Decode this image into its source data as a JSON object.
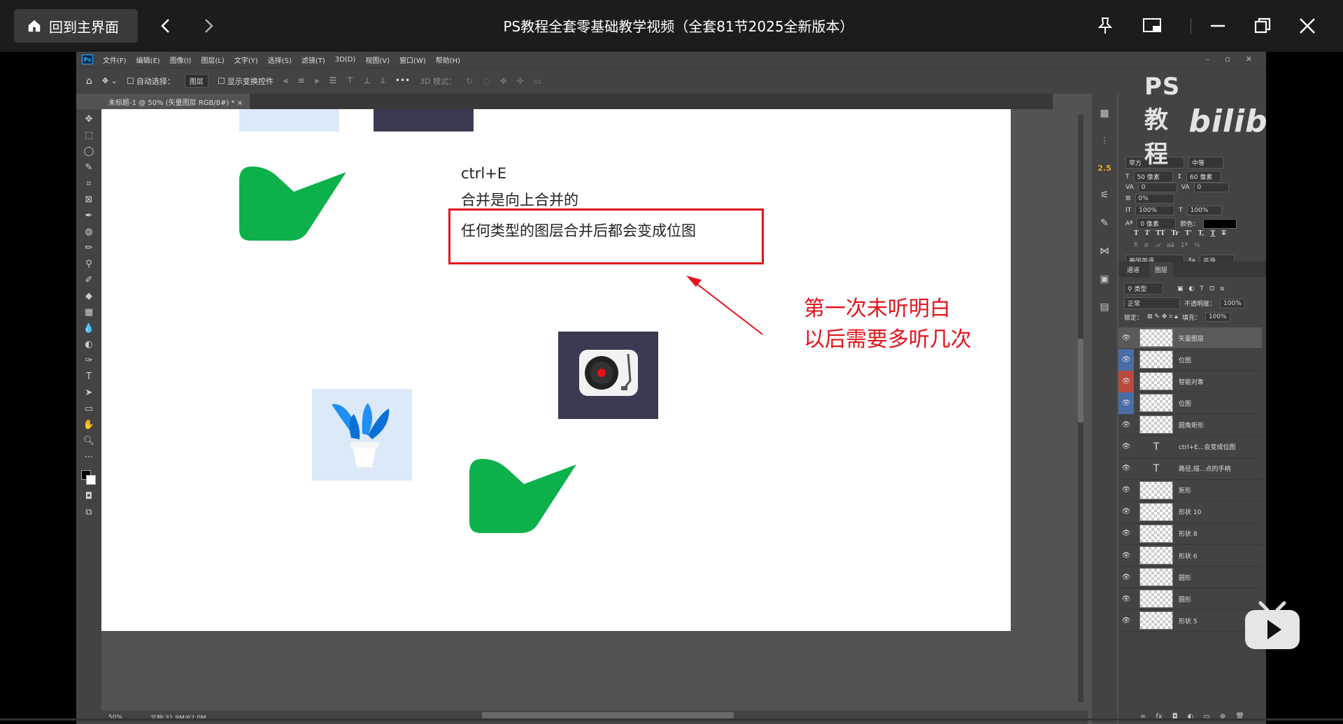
{
  "window": {
    "home_label": "回到主界面",
    "title": "PS教程全套零基础教学视频（全套81节2025全新版本）"
  },
  "ps": {
    "menu": [
      "文件(F)",
      "编辑(E)",
      "图像(I)",
      "图层(L)",
      "文字(Y)",
      "选择(S)",
      "滤镜(T)",
      "3D(D)",
      "视图(V)",
      "窗口(W)",
      "帮助(H)"
    ],
    "options": {
      "auto_select": "自动选择：",
      "auto_select_value": "图层",
      "show_transform": "显示变换控件",
      "mode_3d": "3D 模式："
    },
    "doc_tab": "未标题-1 @ 50% (矢量图层 RGB/8#) *",
    "zoom": "50%",
    "doc_size": "文档:31.9M/62.0M"
  },
  "canvas": {
    "shortcut": "ctrl+E",
    "note_line1": "合并是向上合并的",
    "note_line2": "任何类型的图层合并后都会变成位图",
    "annotation_line1": "第一次未听明白",
    "annotation_line2": "以后需要多听几次"
  },
  "char_panel": {
    "font_family": "苹方",
    "font_style": "中等",
    "font_size": "50 像素",
    "leading": "60 像素",
    "kerning": "0",
    "tracking": "0",
    "scale_pct": "0%",
    "v_scale": "100%",
    "h_scale": "100%",
    "baseline": "0 像素",
    "color_label": "颜色：",
    "language": "美国英语",
    "aa": "平滑",
    "style_glyphs": [
      "T",
      "T",
      "TT",
      "Tr",
      "T'",
      "T,",
      "T",
      "T"
    ]
  },
  "layers_panel": {
    "tabs": [
      "通道",
      "图层"
    ],
    "filter": "类型",
    "blend_mode": "正常",
    "opacity_label": "不透明度：",
    "opacity": "100%",
    "lock_label": "锁定：",
    "fill_label": "填充：",
    "fill": "100%",
    "layers": [
      {
        "name": "矢量图层",
        "kind": "pixel",
        "selected": true,
        "eye_color": ""
      },
      {
        "name": "位图",
        "kind": "pixel",
        "selected": false,
        "eye_color": "#4a6da8"
      },
      {
        "name": "智能对象",
        "kind": "pixel",
        "selected": false,
        "eye_color": "#b84a3e"
      },
      {
        "name": "位图",
        "kind": "pixel",
        "selected": false,
        "eye_color": "#4a6da8"
      },
      {
        "name": "圆角矩形",
        "kind": "pixel",
        "selected": false,
        "eye_color": ""
      },
      {
        "name": "ctrl+E...会变成位图",
        "kind": "type",
        "selected": false,
        "eye_color": ""
      },
      {
        "name": "路径,描...点的手柄",
        "kind": "type",
        "selected": false,
        "eye_color": ""
      },
      {
        "name": "矩形",
        "kind": "pixel",
        "selected": false,
        "eye_color": ""
      },
      {
        "name": "形状 10",
        "kind": "pixel",
        "selected": false,
        "eye_color": ""
      },
      {
        "name": "形状 8",
        "kind": "pixel",
        "selected": false,
        "eye_color": ""
      },
      {
        "name": "形状 6",
        "kind": "pixel",
        "selected": false,
        "eye_color": ""
      },
      {
        "name": "圆形",
        "kind": "pixel",
        "selected": false,
        "eye_color": ""
      },
      {
        "name": "圆形",
        "kind": "pixel",
        "selected": false,
        "eye_color": ""
      },
      {
        "name": "形状 5",
        "kind": "pixel",
        "selected": false,
        "eye_color": ""
      }
    ]
  },
  "watermark": {
    "text": "PS教程",
    "brand": "bilibili"
  },
  "colors": {
    "accent_red": "#e3131b",
    "green_shape": "#0db14b",
    "tile_light": "#dbe9f8",
    "tile_dark": "#3a3b52"
  }
}
